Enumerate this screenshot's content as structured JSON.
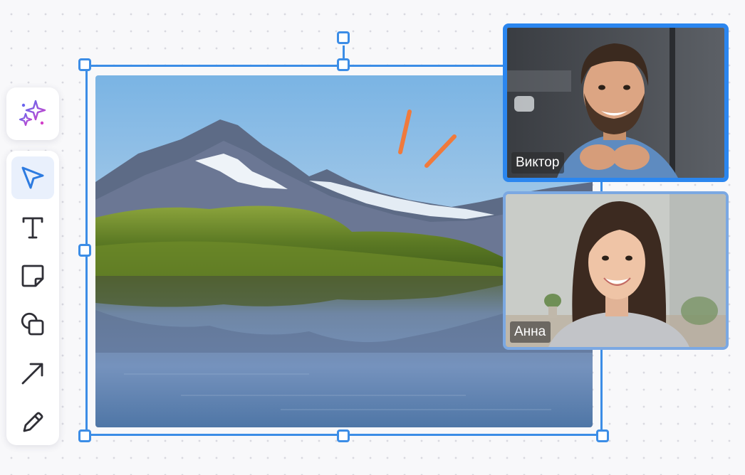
{
  "toolbar": {
    "ai_tool": "sparkle-icon",
    "tools": [
      {
        "id": "select",
        "icon": "cursor-arrow-icon",
        "active": true
      },
      {
        "id": "text",
        "icon": "text-icon",
        "active": false
      },
      {
        "id": "sticky",
        "icon": "sticky-note-icon",
        "active": false
      },
      {
        "id": "shapes",
        "icon": "shapes-icon",
        "active": false
      },
      {
        "id": "arrow",
        "icon": "arrow-icon",
        "active": false
      },
      {
        "id": "pen",
        "icon": "pen-icon",
        "active": false
      }
    ]
  },
  "colors": {
    "selection": "#3c8de6",
    "active_tool_bg": "#e9f0fc",
    "active_speaker_border": "#2b86ef",
    "accent_stroke": "#f07a3c"
  },
  "participants": [
    {
      "name": "Виктор",
      "speaking": true
    },
    {
      "name": "Анна",
      "speaking": false
    }
  ]
}
